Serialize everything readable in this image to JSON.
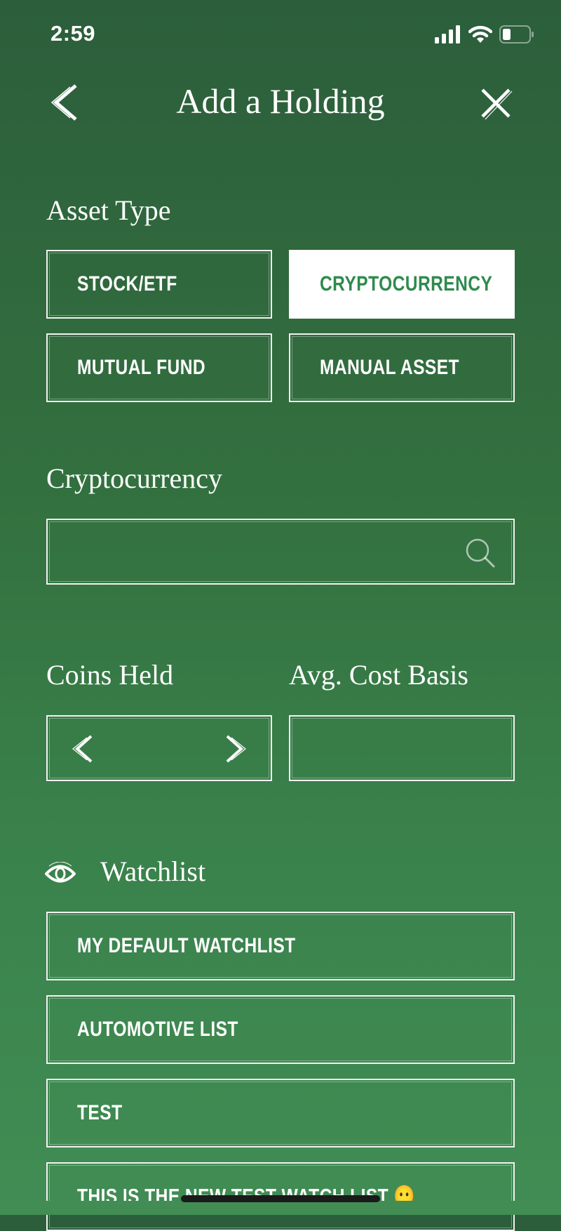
{
  "status_bar": {
    "time": "2:59",
    "icons": [
      "cellular-signal-icon",
      "wifi-icon",
      "battery-icon"
    ],
    "battery_level": 0.3
  },
  "header": {
    "title": "Add a Holding",
    "back_icon": "chevron-left-icon",
    "close_icon": "close-icon"
  },
  "asset_type": {
    "label": "Asset Type",
    "options": [
      {
        "label": "STOCK/ETF",
        "selected": false
      },
      {
        "label": "CRYPTOCURRENCY",
        "selected": true
      },
      {
        "label": "MUTUAL FUND",
        "selected": false
      },
      {
        "label": "MANUAL ASSET",
        "selected": false
      }
    ]
  },
  "cryptocurrency": {
    "label": "Cryptocurrency",
    "value": "",
    "placeholder": "",
    "icon": "search-icon"
  },
  "coins_held": {
    "label": "Coins Held",
    "value": "",
    "decrement_icon": "chevron-left-icon",
    "increment_icon": "chevron-right-icon"
  },
  "avg_cost_basis": {
    "label": "Avg. Cost Basis",
    "value": ""
  },
  "watchlist": {
    "label": "Watchlist",
    "icon": "eye-icon",
    "items": [
      {
        "label": "MY DEFAULT WATCHLIST"
      },
      {
        "label": "AUTOMOTIVE LIST"
      },
      {
        "label": "TEST"
      },
      {
        "label": "THIS IS THE NEW TEST WATCH LIST 😶"
      }
    ]
  },
  "colors": {
    "background_top": "#2c5e3b",
    "background_bottom": "#418d54",
    "selected_text": "#2f8a4e",
    "border": "#f2f2f2"
  }
}
